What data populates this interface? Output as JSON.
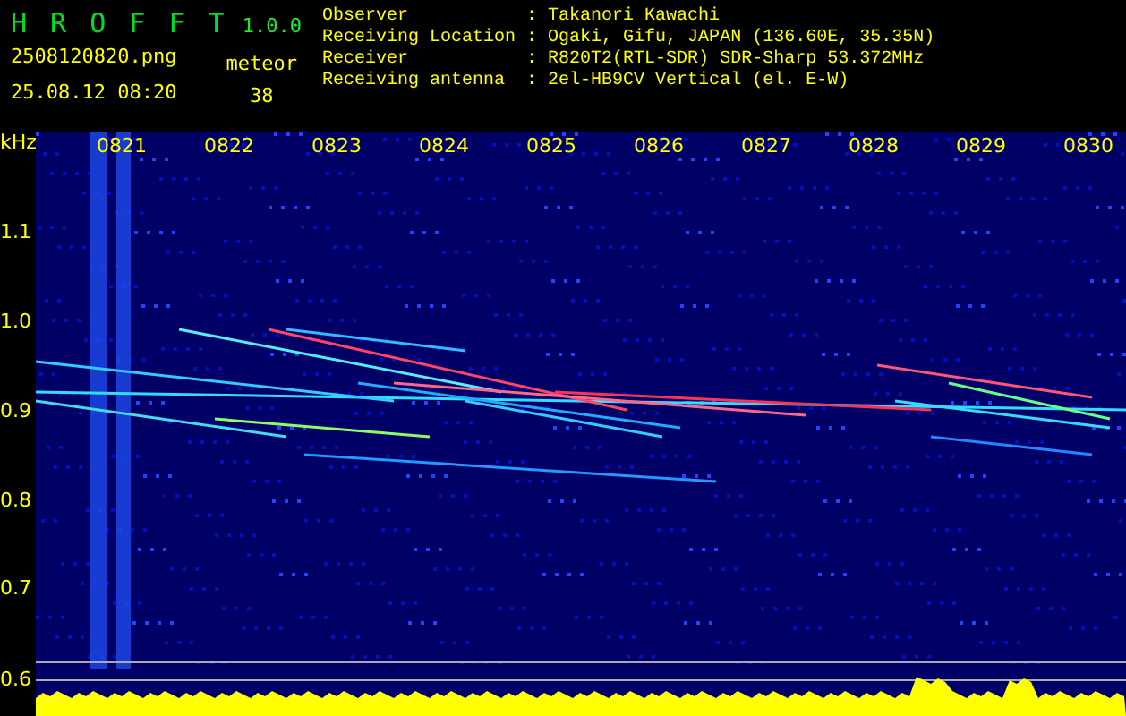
{
  "header": {
    "title": "H R O F F T",
    "version": "1.0.0",
    "filename": "2508120820.png",
    "datetime": "25.08.12 08:20",
    "meteor_label": "meteor",
    "meteor_count": "38",
    "info": [
      {
        "label": "Observer",
        "separator": ":",
        "value": "Takanori Kawachi"
      },
      {
        "label": "Receiving Location",
        "separator": ":",
        "value": "Ogaki, Gifu, JAPAN (136.60E, 35.35N)"
      },
      {
        "label": "Receiver",
        "separator": ":",
        "value": "R820T2(RTL-SDR) SDR-Sharp 53.372MHz"
      },
      {
        "label": "Receiving antenna",
        "separator": ":",
        "value": "2el-HB9CV Vertical (el. E-W)"
      }
    ]
  },
  "spectrogram": {
    "unit": "kHz",
    "y_labels": [
      "1.1",
      "1.0",
      "0.9",
      "0.8",
      "0.7",
      "0.6"
    ],
    "time_labels": [
      "0821",
      "0822",
      "0823",
      "0824",
      "0825",
      "0826",
      "0827",
      "0828",
      "0829",
      "0830"
    ]
  }
}
